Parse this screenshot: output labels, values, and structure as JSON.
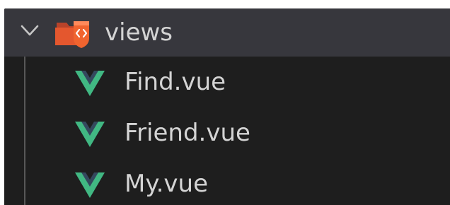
{
  "explorer": {
    "folder": {
      "name": "views",
      "expanded": true,
      "icon": "folder-code-icon",
      "icon_color": "#e4572e"
    },
    "files": [
      {
        "name": "Find.vue",
        "icon": "vue-icon"
      },
      {
        "name": "Friend.vue",
        "icon": "vue-icon"
      },
      {
        "name": "My.vue",
        "icon": "vue-icon"
      }
    ],
    "colors": {
      "background": "#1e1e1e",
      "selected_row": "#37373d",
      "text": "#d4d4d4",
      "vue_green": "#41b883",
      "vue_dark": "#34495e"
    }
  }
}
